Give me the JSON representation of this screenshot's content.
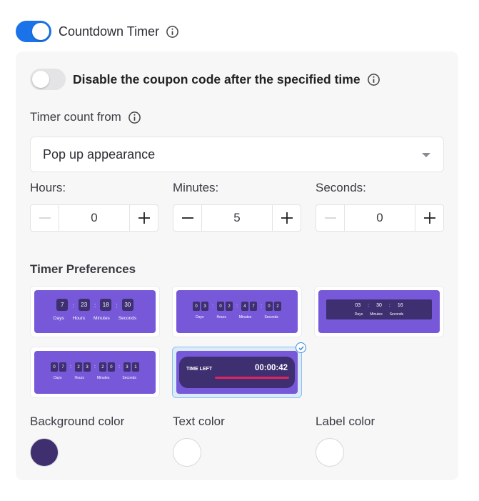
{
  "countdown": {
    "label": "Countdown Timer",
    "enabled": true
  },
  "disable_coupon": {
    "label": "Disable the coupon code after the specified time",
    "enabled": false
  },
  "timer_count_from": {
    "label": "Timer count from",
    "selected": "Pop up appearance"
  },
  "duration": {
    "hours": {
      "label": "Hours:",
      "value": "0"
    },
    "minutes": {
      "label": "Minutes:",
      "value": "5"
    },
    "seconds": {
      "label": "Seconds:",
      "value": "0"
    }
  },
  "preferences": {
    "title": "Timer Preferences",
    "style1": {
      "digits": [
        "7",
        "23",
        "18",
        "30"
      ],
      "labels": [
        "Days",
        "Hours",
        "Minutes",
        "Seconds"
      ]
    },
    "style2": {
      "digits": [
        "0",
        "3",
        "0",
        "2",
        "4",
        "7",
        "0",
        "2"
      ],
      "labels": [
        "Days",
        "Hours",
        "Minutes",
        "Seconds"
      ]
    },
    "style3": {
      "digits": [
        "03",
        "30",
        "16"
      ],
      "labels": [
        "Days",
        "Minutes",
        "Seconds"
      ]
    },
    "style4": {
      "digits": [
        "0",
        "7",
        "2",
        "3",
        "2",
        "0",
        "3",
        "1"
      ],
      "labels": [
        "Days",
        "Hours",
        "Minutes",
        "Seconds"
      ]
    },
    "style5": {
      "label": "TIME LEFT",
      "time": "00:00:42",
      "selected": true
    }
  },
  "colors": {
    "background": {
      "label": "Background color",
      "value": "#3f2f6e"
    },
    "text": {
      "label": "Text color",
      "value": "#ffffff"
    },
    "label": {
      "label": "Label color",
      "value": "#ffffff"
    }
  },
  "accent": "#1a73e8",
  "tile_color": "#7658d8"
}
